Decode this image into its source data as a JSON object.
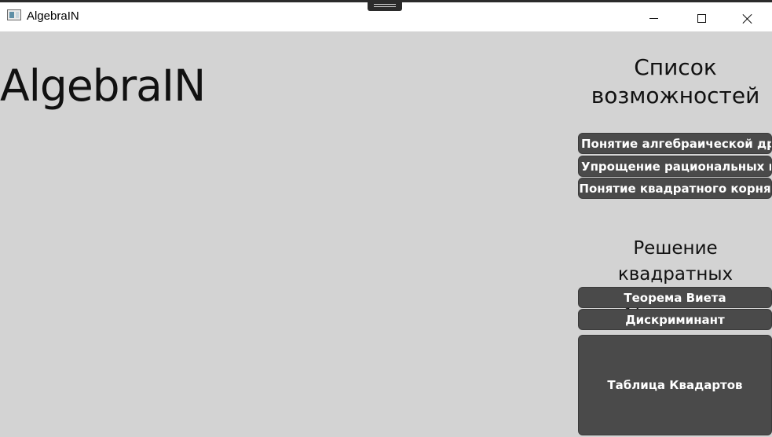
{
  "window": {
    "title": "AlgebraIN"
  },
  "main": {
    "heading": "AlgebraIN"
  },
  "sidebar": {
    "features_title": "Список возможностей",
    "feature_buttons": [
      "Понятие алгебраической дроби",
      "Упрощение рациональных выражений",
      "Понятие квадратного корня"
    ],
    "quadratic_title": "Решение квадратных уравнений",
    "quadratic_buttons": [
      "Теорема Виета",
      "Дискриминант",
      "Таблица Квадартов"
    ]
  },
  "colors": {
    "background": "#d3d3d3",
    "button": "#4a4a4a",
    "button_text": "#ffffff",
    "titlebar": "#ffffff"
  },
  "icons": [
    "app-window-icon",
    "minimize-icon",
    "maximize-icon",
    "close-icon"
  ]
}
